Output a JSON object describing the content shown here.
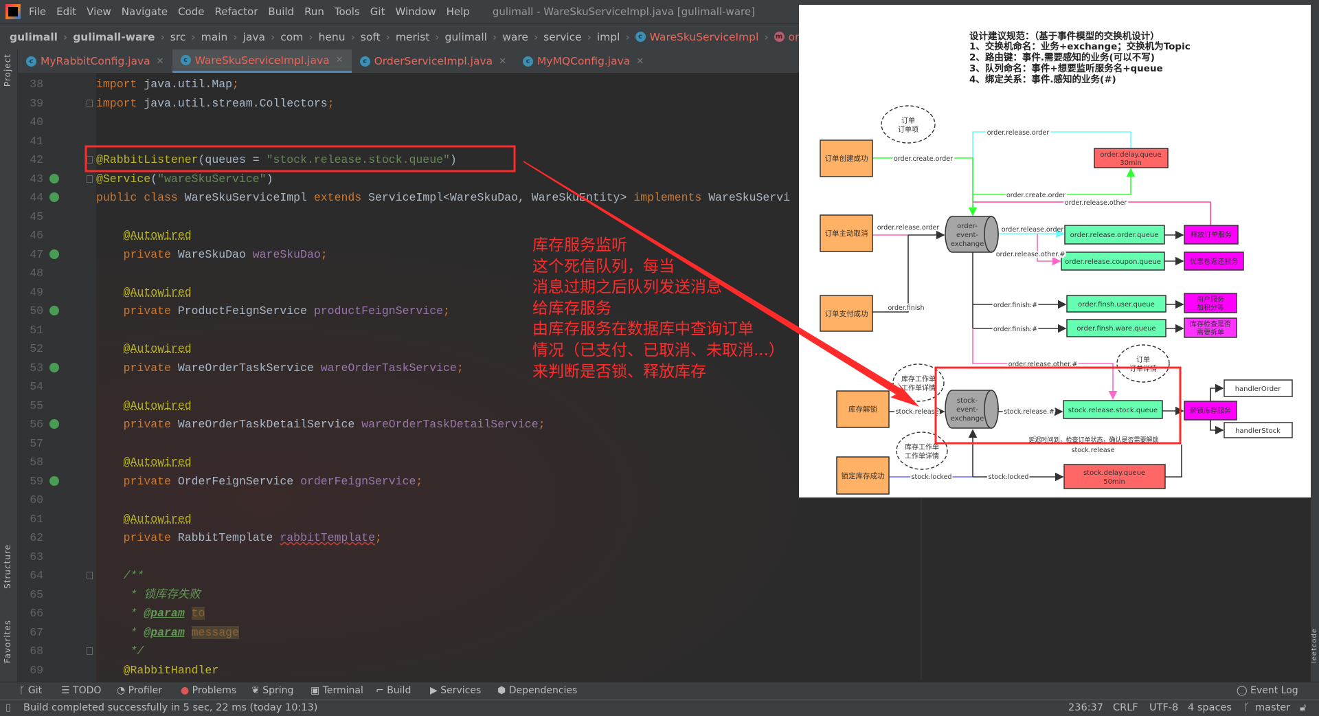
{
  "menu": {
    "items": [
      "File",
      "Edit",
      "View",
      "Navigate",
      "Code",
      "Refactor",
      "Build",
      "Run",
      "Tools",
      "Git",
      "Window",
      "Help"
    ],
    "window_title": "gulimall - WareSkuServiceImpl.java [gulimall-ware]"
  },
  "breadcrumb": [
    "gulimall",
    "gulimall-ware",
    "src",
    "main",
    "java",
    "com",
    "henu",
    "soft",
    "merist",
    "gulimall",
    "ware",
    "service",
    "impl",
    "WareSkuServiceImpl",
    "orderLockStoc"
  ],
  "tabs": [
    {
      "label": "MyRabbitConfig.java",
      "active": false
    },
    {
      "label": "WareSkuServiceImpl.java",
      "active": true
    },
    {
      "label": "OrderServiceImpl.java",
      "active": false
    },
    {
      "label": "MyMQConfig.java",
      "active": false
    }
  ],
  "side_panels": {
    "project": "Project",
    "structure": "Structure",
    "favorites": "Favorites",
    "leetcode": "leetcode"
  },
  "code_lines": [
    {
      "n": "38",
      "t": [
        [
          "import ",
          "kw"
        ],
        [
          "java.util.Map",
          "plain"
        ],
        [
          ";",
          "kw"
        ]
      ]
    },
    {
      "n": "39",
      "fold": true,
      "t": [
        [
          "import ",
          "kw"
        ],
        [
          "java.util.stream.Collectors",
          "plain"
        ],
        [
          ";",
          "kw"
        ]
      ]
    },
    {
      "n": "40",
      "t": []
    },
    {
      "n": "41",
      "t": []
    },
    {
      "n": "42",
      "fold": true,
      "t": [
        [
          "@RabbitListener",
          "ann"
        ],
        [
          "(queues = ",
          "plain"
        ],
        [
          "\"stock.release.stock.queue\"",
          "str"
        ],
        [
          ")",
          "plain"
        ]
      ]
    },
    {
      "n": "43",
      "icon": true,
      "fold": true,
      "t": [
        [
          "@Service",
          "ann"
        ],
        [
          "(",
          "plain"
        ],
        [
          "\"wareSkuService\"",
          "str"
        ],
        [
          ")",
          "plain"
        ]
      ]
    },
    {
      "n": "44",
      "icon": true,
      "t": [
        [
          "public class ",
          "kw"
        ],
        [
          "WareSkuServiceImpl ",
          "plain"
        ],
        [
          "extends ",
          "kw"
        ],
        [
          "ServiceImpl<WareSkuDao, WareSkuEntity> ",
          "plain"
        ],
        [
          "implements ",
          "kw"
        ],
        [
          "WareSkuServi",
          "plain"
        ]
      ]
    },
    {
      "n": "45",
      "t": []
    },
    {
      "n": "46",
      "t": [
        [
          "    ",
          "plain"
        ],
        [
          "@Autowired",
          "ann annul"
        ]
      ]
    },
    {
      "n": "47",
      "icon": true,
      "t": [
        [
          "    ",
          "plain"
        ],
        [
          "private ",
          "kw"
        ],
        [
          "WareSkuDao ",
          "plain"
        ],
        [
          "wareSkuDao",
          "field"
        ],
        [
          ";",
          "kw"
        ]
      ]
    },
    {
      "n": "48",
      "t": []
    },
    {
      "n": "49",
      "t": [
        [
          "    ",
          "plain"
        ],
        [
          "@Autowired",
          "ann annul"
        ]
      ]
    },
    {
      "n": "50",
      "icon": true,
      "t": [
        [
          "    ",
          "plain"
        ],
        [
          "private ",
          "kw"
        ],
        [
          "ProductFeignService ",
          "plain"
        ],
        [
          "productFeignService",
          "field"
        ],
        [
          ";",
          "kw"
        ]
      ]
    },
    {
      "n": "51",
      "t": []
    },
    {
      "n": "52",
      "t": [
        [
          "    ",
          "plain"
        ],
        [
          "@Autowired",
          "ann annul"
        ]
      ]
    },
    {
      "n": "53",
      "icon": true,
      "t": [
        [
          "    ",
          "plain"
        ],
        [
          "private ",
          "kw"
        ],
        [
          "WareOrderTaskService ",
          "plain"
        ],
        [
          "wareOrderTaskService",
          "field"
        ],
        [
          ";",
          "kw"
        ]
      ]
    },
    {
      "n": "54",
      "t": []
    },
    {
      "n": "55",
      "t": [
        [
          "    ",
          "plain"
        ],
        [
          "@Autowired",
          "ann annul"
        ]
      ]
    },
    {
      "n": "56",
      "icon": true,
      "t": [
        [
          "    ",
          "plain"
        ],
        [
          "private ",
          "kw"
        ],
        [
          "WareOrderTaskDetailService ",
          "plain"
        ],
        [
          "wareOrderTaskDetailService",
          "field"
        ],
        [
          ";",
          "kw"
        ]
      ]
    },
    {
      "n": "57",
      "t": []
    },
    {
      "n": "58",
      "t": [
        [
          "    ",
          "plain"
        ],
        [
          "@Autowired",
          "ann annul"
        ]
      ]
    },
    {
      "n": "59",
      "icon": true,
      "t": [
        [
          "    ",
          "plain"
        ],
        [
          "private ",
          "kw"
        ],
        [
          "OrderFeignService ",
          "plain"
        ],
        [
          "orderFeignService",
          "field"
        ],
        [
          ";",
          "kw"
        ]
      ]
    },
    {
      "n": "60",
      "t": []
    },
    {
      "n": "61",
      "t": [
        [
          "    ",
          "plain"
        ],
        [
          "@Autowired",
          "ann annul"
        ]
      ]
    },
    {
      "n": "62",
      "t": [
        [
          "    ",
          "plain"
        ],
        [
          "private ",
          "kw"
        ],
        [
          "RabbitTemplate ",
          "plain"
        ],
        [
          "rabbitTemplate",
          "field ul"
        ],
        [
          ";",
          "kw"
        ]
      ]
    },
    {
      "n": "63",
      "t": []
    },
    {
      "n": "64",
      "fold": true,
      "t": [
        [
          "    ",
          "plain"
        ],
        [
          "/**",
          "comment"
        ]
      ]
    },
    {
      "n": "65",
      "t": [
        [
          "     * 锁库存失败",
          "comment"
        ]
      ]
    },
    {
      "n": "66",
      "t": [
        [
          "     * ",
          "comment"
        ],
        [
          "@param",
          "doctag"
        ],
        [
          " ",
          "comment"
        ],
        [
          "to",
          "param"
        ]
      ]
    },
    {
      "n": "67",
      "t": [
        [
          "     * ",
          "comment"
        ],
        [
          "@param",
          "doctag"
        ],
        [
          " ",
          "comment"
        ],
        [
          "message",
          "param"
        ]
      ]
    },
    {
      "n": "68",
      "fold": true,
      "t": [
        [
          "     */",
          "comment"
        ]
      ]
    },
    {
      "n": "69",
      "t": [
        [
          "    ",
          "plain"
        ],
        [
          "@RabbitHandler",
          "ann"
        ]
      ]
    }
  ],
  "annotation_note": [
    "库存服务监听",
    "这个死信队列，每当",
    "消息过期之后队列发送消息",
    "给库存服务",
    "由库存服务在数据库中查询订单",
    "情况（已支付、已取消、未取消...）",
    "来判断是否锁、释放库存"
  ],
  "annotation_color": "#ff2b2b",
  "diagram": {
    "title": [
      "设计建议规范：（基于事件模型的交换机设计）",
      "1、交换机命名：业务+exchange；交换机为Topic",
      "2、路由键：事件.需要感知的业务(可以不写)",
      "3、队列命名：事件+想要监听服务名+queue",
      "4、绑定关系：事件.感知的业务(#)"
    ],
    "events": {
      "order_created": "订单创建成功",
      "order_cancel": "订单主动取消",
      "order_paid": "订单支付成功",
      "stock_unlock": "库存解锁",
      "stock_locked": "锁定库存成功"
    },
    "entities": {
      "order": [
        "订单",
        "订单项"
      ],
      "order_detail": [
        "订单",
        "订单详情"
      ],
      "stock_task1": [
        "库存工作单",
        "工作单详情"
      ],
      "stock_task2": [
        "库存工作单",
        "工作单详情"
      ]
    },
    "exchanges": {
      "order": [
        "order-",
        "event-",
        "exchange"
      ],
      "stock": [
        "stock-",
        "event-",
        "exchange"
      ]
    },
    "queues": {
      "order_delay": [
        "order.delay.queue",
        "30min"
      ],
      "order_release": "order.release.order.queue",
      "coupon": "order.release.coupon.queue",
      "finish_user": "order.finsh.user.queue",
      "finish_ware": "order.finsh.ware.queue",
      "stock_release": "stock.release.stock.queue",
      "stock_delay": [
        "stock.delay.queue",
        "50min"
      ]
    },
    "services": {
      "release_order": "释放订单服务",
      "coupon_return": "优惠卷返还服务",
      "user_points": [
        "用户服务",
        "加积分等"
      ],
      "stock_check": [
        "库存检查是否",
        "需要拆单"
      ],
      "unlock_stock": "解锁库存服务",
      "handler_order": "handlerOrder",
      "handler_stock": "handlerStock"
    },
    "routes": {
      "release_order_top": "order.release.order",
      "create_order": "order.create.order",
      "create_order2": "order.create.order",
      "release_other": "order.release.other",
      "release_order_in": "order.release.order",
      "release_order_out": "order.release.order",
      "release_other_hash": "order.release.other.#",
      "finish": "order.finish",
      "finish_hash1": "order.finish.#",
      "finish_hash2": "order.finish.#",
      "release_other_hash2": "order.release.other.#",
      "stock_release": "stock.release",
      "stock_release_hash": "stock.release.#",
      "delay_note": "延迟时间到，检查订单状态，确认是否需要解锁",
      "stock_release2": "stock.release",
      "stock_locked1": "stock.locked",
      "stock_locked2": "stock.locked"
    },
    "colors": {
      "event": "#ffb266",
      "queue": "#66ffb2",
      "delay_queue": "#ff6666",
      "service": "#ff00ff",
      "exchange": "#a6a6a6"
    }
  },
  "toolwindows": [
    "Git",
    "TODO",
    "Profiler",
    "Problems",
    "Spring",
    "Terminal",
    "Build",
    "Services",
    "Dependencies"
  ],
  "event_log": "Event Log",
  "status": {
    "message": "Build completed successfully in 5 sec, 22 ms (today 10:13)",
    "position": "236:37",
    "line_sep": "CRLF",
    "encoding": "UTF-8",
    "indent": "4 spaces",
    "branch": "master"
  }
}
